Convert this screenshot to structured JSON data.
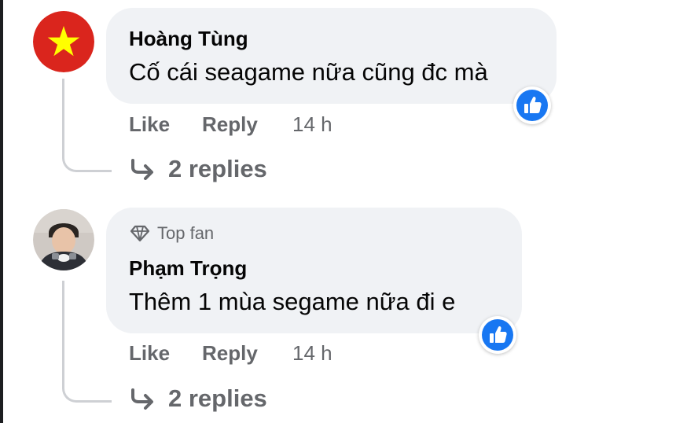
{
  "colors": {
    "bubble": "#f0f2f5",
    "secondary_text": "#65676b",
    "like_blue": "#1877f2",
    "flag_red": "#da251d",
    "flag_star": "#ffff00"
  },
  "comments": [
    {
      "avatar_icon": "vietnam-flag-avatar",
      "author": "Hoàng Tùng",
      "text": "Cố cái seagame nữa cũng đc mà",
      "reaction_icon": "like-reaction-icon",
      "actions": {
        "like": "Like",
        "reply": "Reply",
        "time": "14 h"
      },
      "replies": "2 replies"
    },
    {
      "avatar_icon": "user-photo-avatar",
      "badge": "Top fan",
      "badge_icon": "diamond-icon",
      "author": "Phạm Trọng",
      "text": "Thêm 1 mùa segame nữa đi e",
      "reaction_icon": "like-reaction-icon",
      "actions": {
        "like": "Like",
        "reply": "Reply",
        "time": "14 h"
      },
      "replies": "2 replies"
    }
  ]
}
